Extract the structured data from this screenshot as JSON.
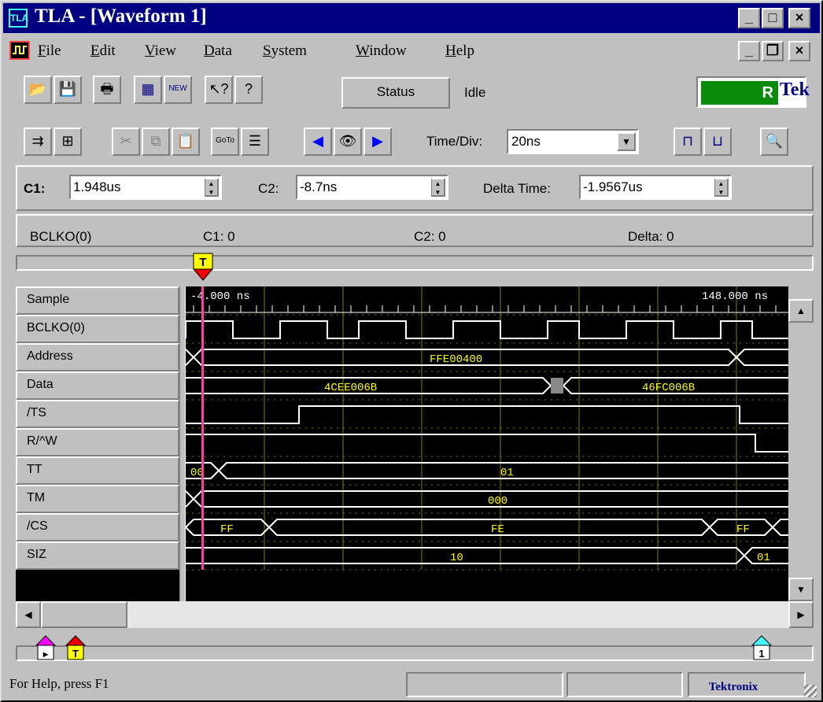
{
  "window": {
    "title": "TLA - [Waveform 1]",
    "app_icon": "tla-icon",
    "caption_buttons": [
      "minimize-icon",
      "maximize-icon",
      "close-icon"
    ]
  },
  "menu": {
    "items": [
      {
        "label": "File",
        "accel": "F"
      },
      {
        "label": "Edit",
        "accel": "E"
      },
      {
        "label": "View",
        "accel": "V"
      },
      {
        "label": "Data",
        "accel": "D"
      },
      {
        "label": "System",
        "accel": "S"
      },
      {
        "label": "Window",
        "accel": "W"
      },
      {
        "label": "Help",
        "accel": "H"
      }
    ]
  },
  "toolbar": {
    "status_label": "Status",
    "state_text": "Idle",
    "rtek_label": "R",
    "tek_label": "Tek",
    "timediv_label": "Time/Div:",
    "timediv_value": "20ns"
  },
  "cursors": {
    "c1_label": "C1:",
    "c1_value": "1.948us",
    "c2_label": "C2:",
    "c2_value": "-8.7ns",
    "delta_label": "Delta Time:",
    "delta_value": "-1.9567us"
  },
  "readout": {
    "signal": "BCLKO(0)",
    "c1": "C1: 0",
    "c2": "C2: 0",
    "delta": "Delta: 0"
  },
  "waveform": {
    "time_start": "-4.000 ns",
    "time_end": "148.000 ns",
    "signals": [
      "Sample",
      "BCLKO(0)",
      "Address",
      "Data",
      "/TS",
      "R/^W",
      "TT",
      "TM",
      "/CS",
      "SIZ"
    ],
    "bus_values": {
      "address": "FFE00400",
      "data_1": "4CEE006B",
      "data_2": "46FC006B",
      "tt_1": "00",
      "tt_2": "01",
      "tm": "000",
      "cs_1": "FF",
      "cs_2": "FE",
      "cs_3": "FF",
      "siz_1": "10",
      "siz_2": "01"
    },
    "cursor_marker_label": "T",
    "bottom_markers": [
      "1",
      "T"
    ]
  },
  "colors": {
    "titlebar": "#000080",
    "trace": "#ffffff",
    "bus_value": "#ffff00",
    "grid": "#808000",
    "cursor": "#ff40a0"
  },
  "status_bar": {
    "help_text": "For Help, press F1",
    "brand": "Tektronix"
  }
}
